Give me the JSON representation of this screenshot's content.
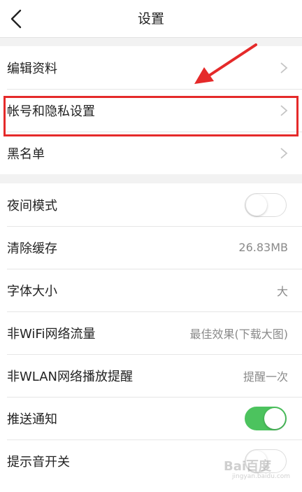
{
  "header": {
    "title": "设置",
    "back_icon": "chevron-left-icon"
  },
  "group1": [
    {
      "label": "编辑资料",
      "icon": "chevron-right-icon"
    },
    {
      "label": "帐号和隐私设置",
      "icon": "chevron-right-icon",
      "highlighted": true
    },
    {
      "label": "黑名单",
      "icon": "chevron-right-icon"
    }
  ],
  "group2": [
    {
      "label": "夜间模式",
      "toggle": "off"
    },
    {
      "label": "清除缓存",
      "value": "26.83MB"
    },
    {
      "label": "字体大小",
      "value": "大"
    },
    {
      "label": "非WiFi网络流量",
      "value": "最佳效果(下载大图)"
    },
    {
      "label": "非WLAN网络播放提醒",
      "value": "提醒一次"
    },
    {
      "label": "推送通知",
      "toggle": "on"
    },
    {
      "label": "提示音开关",
      "toggle": "off"
    }
  ],
  "watermark": {
    "text": "Bai百度",
    "sub": "jingyan.baidu.com"
  },
  "colors": {
    "toggle_on": "#4cc35e",
    "annotation": "#e52a2a"
  }
}
